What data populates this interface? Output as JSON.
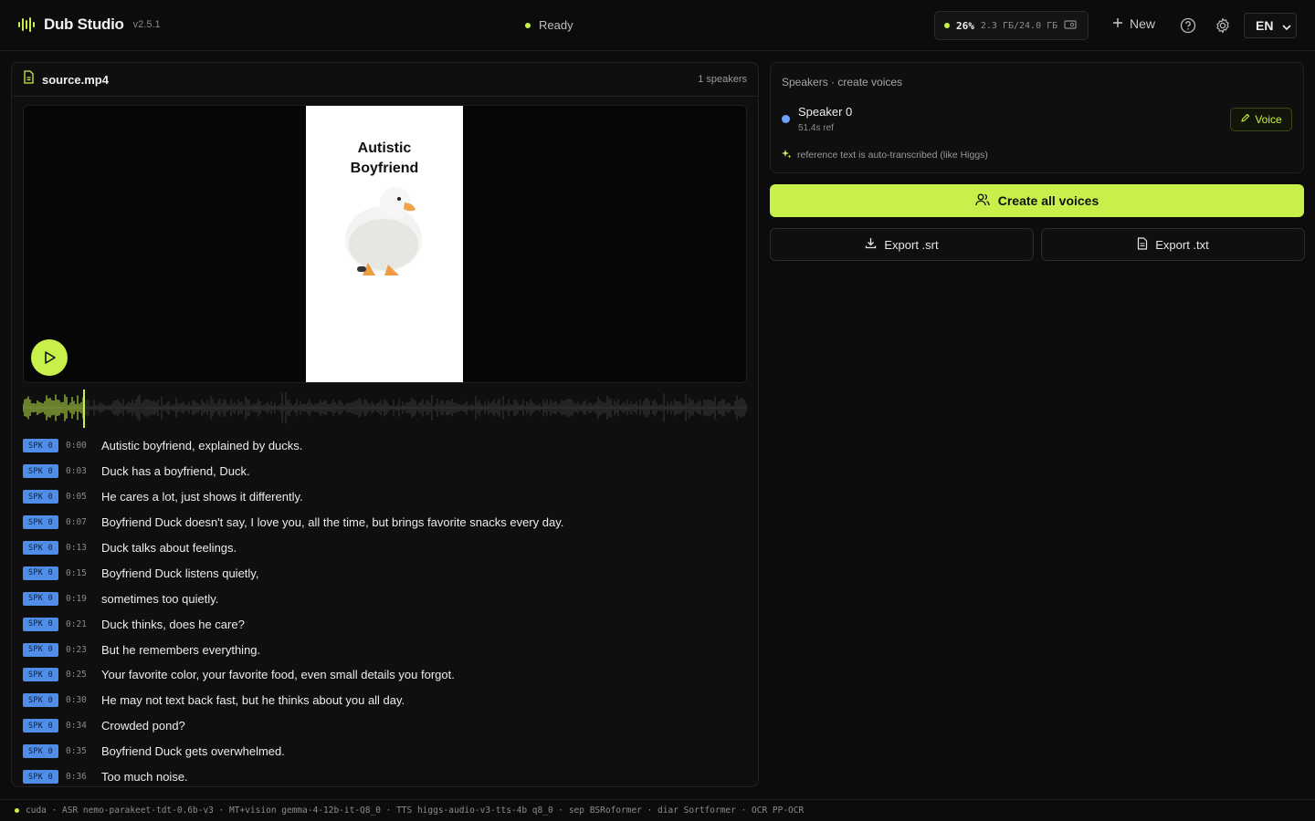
{
  "app": {
    "name": "Dub Studio",
    "version": "v2.5.1",
    "status": "Ready"
  },
  "gpu": {
    "percent": "26%",
    "memory": "2.3 ГБ/24.0 ГБ"
  },
  "header": {
    "new_label": "New",
    "language": "EN",
    "help_icon": "help-circle-icon",
    "settings_icon": "gear-icon"
  },
  "source": {
    "file_name": "source.mp4",
    "speakers_count": "1 speakers",
    "frame_title_line1": "Autistic",
    "frame_title_line2": "Boyfriend"
  },
  "playback": {
    "progress": 0.085
  },
  "transcript": [
    {
      "speaker": "SPK 0",
      "time": "0:00",
      "text": "Autistic boyfriend, explained by ducks."
    },
    {
      "speaker": "SPK 0",
      "time": "0:03",
      "text": "Duck has a boyfriend, Duck."
    },
    {
      "speaker": "SPK 0",
      "time": "0:05",
      "text": "He cares a lot, just shows it differently."
    },
    {
      "speaker": "SPK 0",
      "time": "0:07",
      "text": "Boyfriend Duck doesn't say, I love you, all the time, but brings favorite snacks every day."
    },
    {
      "speaker": "SPK 0",
      "time": "0:13",
      "text": "Duck talks about feelings."
    },
    {
      "speaker": "SPK 0",
      "time": "0:15",
      "text": "Boyfriend Duck listens quietly,"
    },
    {
      "speaker": "SPK 0",
      "time": "0:19",
      "text": "sometimes too quietly."
    },
    {
      "speaker": "SPK 0",
      "time": "0:21",
      "text": "Duck thinks, does he care?"
    },
    {
      "speaker": "SPK 0",
      "time": "0:23",
      "text": "But he remembers everything."
    },
    {
      "speaker": "SPK 0",
      "time": "0:25",
      "text": "Your favorite color, your favorite food, even small details you forgot."
    },
    {
      "speaker": "SPK 0",
      "time": "0:30",
      "text": "He may not text back fast, but he thinks about you all day."
    },
    {
      "speaker": "SPK 0",
      "time": "0:34",
      "text": "Crowded pond?"
    },
    {
      "speaker": "SPK 0",
      "time": "0:35",
      "text": "Boyfriend Duck gets overwhelmed."
    },
    {
      "speaker": "SPK 0",
      "time": "0:36",
      "text": "Too much noise."
    }
  ],
  "speakers_panel": {
    "title": "Speakers · create voices",
    "speakers": [
      {
        "name": "Speaker 0",
        "ref": "51.4s ref",
        "voice_label": "Voice",
        "color": "#6ea2ff"
      }
    ],
    "note": "reference text is auto-transcribed (like Higgs)"
  },
  "actions": {
    "create_all": "Create all voices",
    "export_srt": "Export .srt",
    "export_txt": "Export .txt"
  },
  "footer": {
    "text": "cuda · ASR nemo-parakeet-tdt-0.6b-v3 · MT+vision gemma-4-12b-it-Q8_0 · TTS higgs-audio-v3-tts-4b q8_0 · sep BSRoformer · diar Sortformer · OCR PP-OCR"
  },
  "colors": {
    "accent": "#c7f14a",
    "speaker_badge": "#4f8de8",
    "background": "#0c0c0c"
  }
}
